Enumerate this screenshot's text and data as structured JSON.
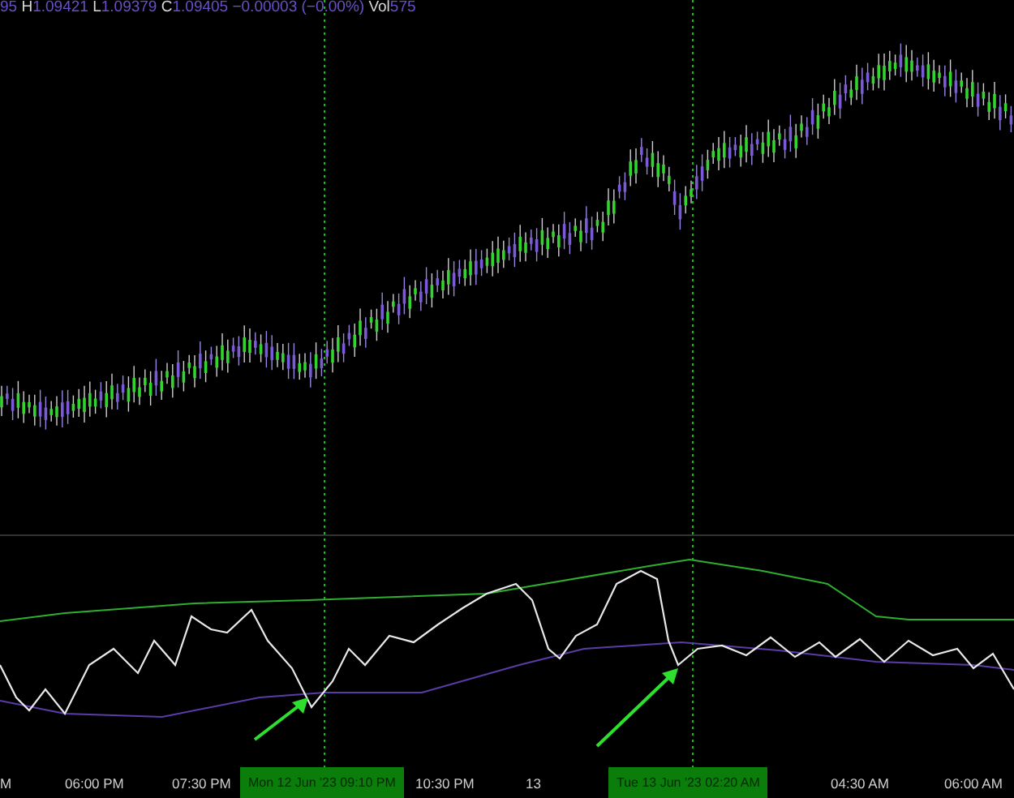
{
  "header": {
    "open_cut": "95",
    "values": [
      {
        "label": "H",
        "value": "1.09421"
      },
      {
        "label": "L",
        "value": "1.09379"
      },
      {
        "label": "C",
        "value": "1.09405"
      }
    ],
    "change": "−0.00003 (−0.00%)",
    "volume_label": "Vol",
    "volume": "575"
  },
  "time_axis": [
    "M",
    "06:00 PM",
    "07:30 PM",
    "10:30 PM",
    "13",
    "04:30 AM",
    "06:00 AM"
  ],
  "crosshair_tags": [
    "Mon 12 Jun '23  09:10 PM",
    "Tue 13 Jun '23  02:20 AM"
  ]
}
